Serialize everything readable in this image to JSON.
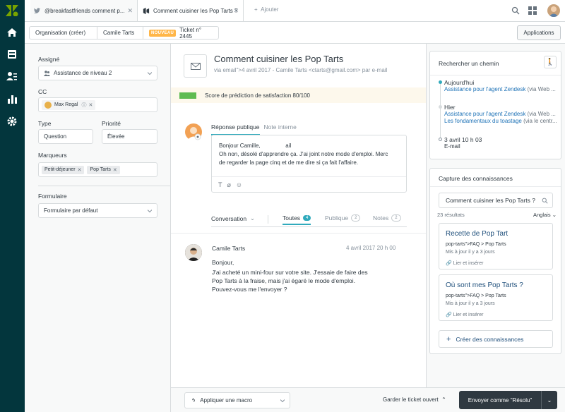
{
  "tabs": [
    {
      "label": "@breakfastfriends comment p...",
      "icon": "twitter-icon"
    },
    {
      "label": "Comment cuisiner les Pop Tarts ?",
      "icon": "ticket-icon"
    }
  ],
  "add_tab_label": "Ajouter",
  "breadcrumb": {
    "org": "Organisation (créer)",
    "user": "Camile Tarts",
    "badge": "NOUVEAU",
    "ticket": "Ticket n° 2445"
  },
  "apps_label": "Applications",
  "left": {
    "assignee_label": "Assigné",
    "assignee_value": "Assistance de niveau 2",
    "cc_label": "CC",
    "cc_person": "Max Regal",
    "type_label": "Type",
    "type_value": "Question",
    "priority_label": "Priorité",
    "priority_value": "Élevée",
    "tags_label": "Marqueurs",
    "tags": [
      "Petit-déjeuner",
      "Pop Tarts"
    ],
    "form_label": "Formulaire",
    "form_value": "Formulaire par défaut"
  },
  "ticket": {
    "title": "Comment cuisiner les Pop Tarts",
    "via": "via email\">4 avril 2017 - Camile Tarts <ctarts@gmail.com> par e-mail",
    "satisfaction": "Score de prédiction de satisfaction 80/100",
    "satisfaction_score": 80,
    "reply_tabs": [
      "Réponse publique",
      "Note interne"
    ],
    "reply_lines": [
      "Bonjour Camille,                ail",
      "Oh non, désolé d'apprendre ça. J'ai joint notre mode d'emploi. Merc",
      "de regarder la page cinq et de me dire si ça fait l'affaire."
    ],
    "filter_conversation": "Conversation",
    "filter_all": "Toutes",
    "filter_all_count": "4",
    "filter_public": "Publique",
    "filter_public_count": "2",
    "filter_notes": "Notes",
    "filter_notes_count": "2",
    "message": {
      "author": "Camile Tarts",
      "date": "4 avril 2017 20 h 00",
      "lines": [
        "Bonjour,",
        "J'ai acheté un mini-four sur votre site. J'essaie de faire des",
        "Pop Tarts à la fraise, mais j'ai égaré le mode d'emploi.",
        "Pouvez-vous me l'envoyer ?"
      ]
    }
  },
  "bottom": {
    "macro": "Appliquer une macro",
    "keep_open": "Garder le ticket ouvert",
    "send": "Envoyer comme \"Résolu\""
  },
  "path": {
    "title": "Rechercher un chemin",
    "today": "Aujourd'hui",
    "today_link": "Assistance pour l'agent Zendesk",
    "today_suffix": " (via Web ...",
    "yesterday": "Hier",
    "y_link1": "Assistance pour l'agent Zendesk",
    "y_suffix1": " (via Web ...",
    "y_link2": "Les fondamentaux du toastage",
    "y_suffix2": " (via le centr...",
    "date3": "3 avril 10 h 03",
    "date3_sub": "E-mail"
  },
  "knowledge": {
    "title": "Capture des connaissances",
    "search_value": "Comment cuisiner les Pop Tarts ?",
    "results": "23 résultats",
    "language": "Anglais",
    "articles": [
      {
        "title": "Recette de Pop Tart",
        "path": "pop-tarts\">FAQ > Pop Tarts",
        "updated": "Mis à jour il y a 3 jours",
        "link": "Lier et insérer"
      },
      {
        "title": "Où sont mes Pop Tarts ?",
        "path": "pop-tarts\">FAQ > Pop Tarts",
        "updated": "Mis à jour il y a 3 jours",
        "link": "Lier et insérer"
      }
    ],
    "create": "Créer des connaissances"
  },
  "colors": {
    "nav": "#03363d",
    "brand": "#78a300",
    "accent": "#30aabc"
  }
}
